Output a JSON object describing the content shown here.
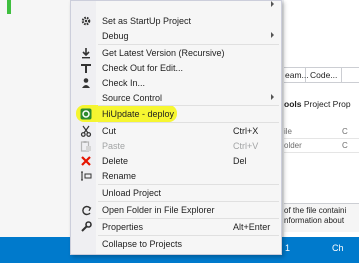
{
  "background": {
    "tabs": [
      "eam...",
      "Code..."
    ],
    "properties_title": "ools",
    "properties_title_rest": "Project Prop",
    "grid": [
      {
        "col1": "ile",
        "col2": "C"
      },
      {
        "col1": "older",
        "col2": "C"
      }
    ],
    "description": [
      "of the file containi",
      "nformation about"
    ],
    "status_number": "1",
    "status_right": "Ch"
  },
  "menu": {
    "items": [
      {
        "label": "Set as StartUp Project",
        "shortcut": "",
        "icon": "gear-icon"
      },
      {
        "label": "Debug",
        "shortcut": "",
        "icon": ""
      },
      {
        "label": "Get Latest Version (Recursive)",
        "shortcut": "",
        "icon": "download-icon"
      },
      {
        "label": "Check Out for Edit...",
        "shortcut": "",
        "icon": "check-out-icon"
      },
      {
        "label": "Check In...",
        "shortcut": "",
        "icon": "check-in-icon"
      },
      {
        "label": "Source Control",
        "shortcut": "",
        "icon": ""
      },
      {
        "label": "HiUpdate - deploy",
        "shortcut": "",
        "icon": "hiupdate-icon"
      },
      {
        "label": "Cut",
        "shortcut": "Ctrl+X",
        "icon": "scissors-icon"
      },
      {
        "label": "Paste",
        "shortcut": "Ctrl+V",
        "icon": "paste-icon"
      },
      {
        "label": "Delete",
        "shortcut": "Del",
        "icon": "delete-icon"
      },
      {
        "label": "Rename",
        "shortcut": "",
        "icon": "rename-icon"
      },
      {
        "label": "Unload Project",
        "shortcut": "",
        "icon": ""
      },
      {
        "label": "Open Folder in File Explorer",
        "shortcut": "",
        "icon": "open-folder-icon"
      },
      {
        "label": "Properties",
        "shortcut": "Alt+Enter",
        "icon": "wrench-icon"
      },
      {
        "label": "Collapse to Projects",
        "shortcut": "",
        "icon": ""
      }
    ]
  },
  "colors": {
    "highlight": "#f5f51f",
    "status_bar": "#007acc",
    "delete_red": "#e51400"
  }
}
